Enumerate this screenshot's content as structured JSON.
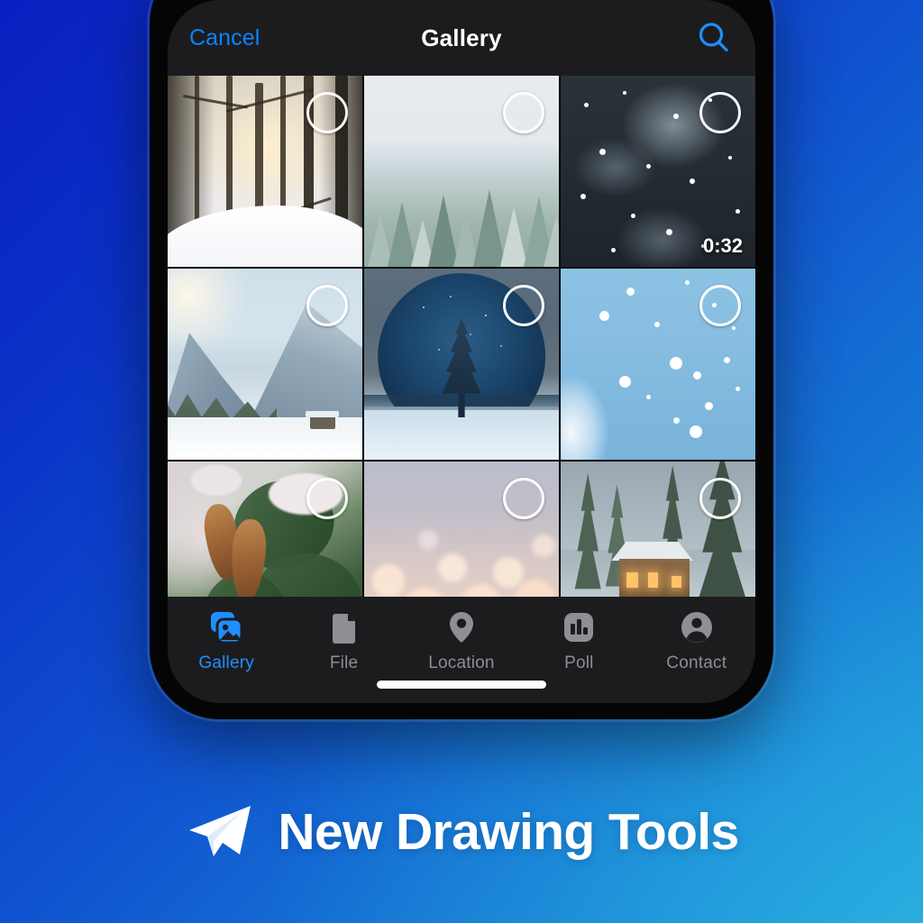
{
  "background": {
    "gradient_from": "#0b1fc2",
    "gradient_to": "#21a3dd"
  },
  "phone": {
    "frame_color": "#050505",
    "screen_bg": "#1c1c1e"
  },
  "navbar": {
    "cancel_label": "Cancel",
    "title": "Gallery",
    "search_icon": "search-icon",
    "accent_color": "#0a84ff"
  },
  "grid": {
    "selection_icon": "selection-circle-icon",
    "items": [
      {
        "id": 1,
        "kind": "photo",
        "description": "Sunlit snowy pine forest",
        "selected": false
      },
      {
        "id": 2,
        "kind": "photo",
        "description": "Foggy frosted forest aerial",
        "selected": false
      },
      {
        "id": 3,
        "kind": "video",
        "description": "Falling snow at night",
        "duration": "0:32",
        "selected": false
      },
      {
        "id": 4,
        "kind": "photo",
        "description": "Snowy mountain valley with cabin",
        "selected": false
      },
      {
        "id": 5,
        "kind": "photo",
        "description": "Lone pine tree under large moon",
        "selected": false
      },
      {
        "id": 6,
        "kind": "photo",
        "description": "Blue sky with falling snowflakes",
        "selected": false
      },
      {
        "id": 7,
        "kind": "photo",
        "description": "Pine cones on snowy branch",
        "selected": false
      },
      {
        "id": 8,
        "kind": "photo",
        "description": "Warm bokeh holiday lights",
        "selected": false
      },
      {
        "id": 9,
        "kind": "photo",
        "description": "Lit wooden cabin among snowy pines",
        "selected": false
      }
    ]
  },
  "tabbar": {
    "active_color": "#1f8fff",
    "inactive_color": "#8e8e93",
    "tabs": [
      {
        "label": "Gallery",
        "icon": "gallery-icon",
        "active": true
      },
      {
        "label": "File",
        "icon": "file-icon",
        "active": false
      },
      {
        "label": "Location",
        "icon": "location-pin-icon",
        "active": false
      },
      {
        "label": "Poll",
        "icon": "poll-bar-chart-icon",
        "active": false
      },
      {
        "label": "Contact",
        "icon": "contact-person-icon",
        "active": false
      }
    ]
  },
  "home_indicator": {
    "visible": true
  },
  "caption": {
    "logo_icon": "telegram-paper-plane-icon",
    "text": "New Drawing Tools"
  }
}
